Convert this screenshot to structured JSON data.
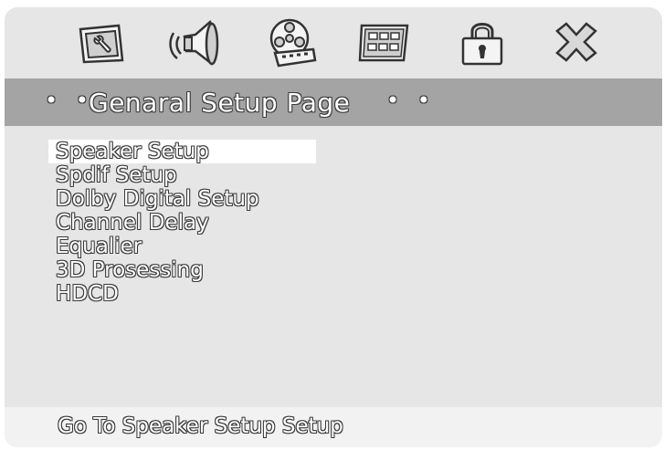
{
  "icons": [
    {
      "name": "general-setup-icon"
    },
    {
      "name": "audio-setup-icon"
    },
    {
      "name": "video-setup-icon"
    },
    {
      "name": "preference-setup-icon"
    },
    {
      "name": "password-setup-icon"
    },
    {
      "name": "exit-icon"
    }
  ],
  "title": {
    "left_dots": "• •",
    "label": "Genaral Setup Page",
    "right_dots": "• •"
  },
  "menu": {
    "items": [
      {
        "label": "Speaker Setup",
        "selected": true
      },
      {
        "label": "Spdif Setup"
      },
      {
        "label": "Dolby Digital Setup"
      },
      {
        "label": "Channel Delay"
      },
      {
        "label": "Equalier"
      },
      {
        "label": "3D Prosessing"
      },
      {
        "label": "HDCD"
      }
    ]
  },
  "footer": {
    "hint": "Go To Speaker Setup Setup"
  },
  "colors": {
    "screen_bg": "#e6e6e6",
    "title_bar": "#a4a4a4",
    "selection": "#ffffff",
    "text_outline": "#3a3a3a"
  }
}
